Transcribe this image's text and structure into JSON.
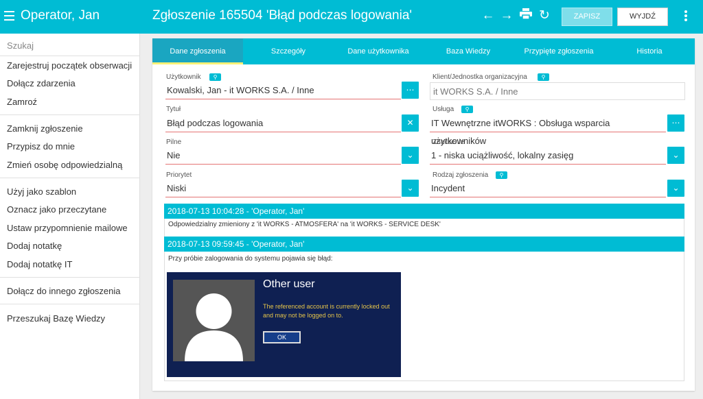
{
  "header": {
    "user": "Operator, Jan",
    "title": "Zgłoszenie 165504 'Błąd podczas logowania'",
    "save_label": "ZAPISZ",
    "exit_label": "WYJDŹ"
  },
  "sidebar": {
    "search": "Szukaj",
    "items": [
      "Zarejestruj początek obserwacji",
      "Dołącz zdarzenia",
      "Zamroź",
      "Zamknij zgłoszenie",
      "Przypisz do mnie",
      "Zmień osobę odpowiedzialną",
      "Użyj jako szablon",
      "Oznacz jako przeczytane",
      "Ustaw przypomnienie mailowe",
      "Dodaj notatkę",
      "Dodaj notatkę IT",
      "Dołącz do innego zgłoszenia",
      "Przeszukaj Bazę Wiedzy"
    ]
  },
  "tabs": [
    "Dane zgłoszenia",
    "Szczegóły",
    "Dane użytkownika",
    "Baza Wiedzy",
    "Przypięte zgłoszenia",
    "Historia"
  ],
  "form": {
    "user_label": "Użytkownik",
    "user_value": "Kowalski, Jan - it WORKS S.A. / Inne",
    "client_label": "Klient/Jednostka organizacyjna",
    "client_value": "it WORKS S.A. / Inne",
    "title_label": "Tytuł",
    "title_value": "Błąd podczas logowania",
    "service_label": "Usługa",
    "service_value": "IT Wewnętrzne itWORKS : Obsługa wsparcia użytkowników",
    "urgent_label": "Pilne",
    "urgent_value": "Nie",
    "importance_label": "Znaczenie",
    "importance_value": "1 - niska uciążliwość, lokalny zasięg",
    "priority_label": "Priorytet",
    "priority_value": "Niski",
    "type_label": "Rodzaj zgłoszenia",
    "type_value": "Incydent"
  },
  "log": [
    {
      "header": "2018-07-13 10:04:28 - 'Operator, Jan'",
      "text": "Odpowiedzialny zmieniony z 'it WORKS - ATMOSFERA' na 'it WORKS - SERVICE DESK'"
    },
    {
      "header": "2018-07-13 09:59:45 - 'Operator, Jan'",
      "text": "Przy próbie zalogowania do systemu pojawia się błąd:"
    }
  ],
  "screenshot": {
    "title": "Other user",
    "message": "The referenced account is currently locked out and may not be logged on to.",
    "ok": "OK"
  }
}
